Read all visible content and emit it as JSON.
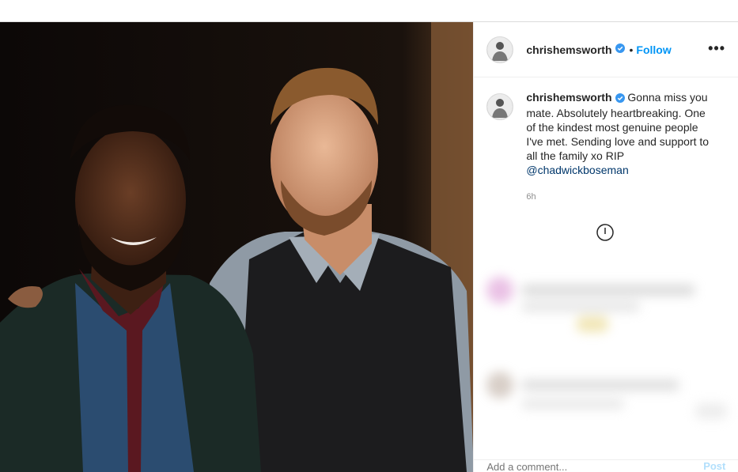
{
  "post": {
    "username": "chrishemsworth",
    "follow_label": "Follow",
    "separator": "•",
    "more_label": "•••",
    "caption_text": "Gonna miss you mate. Absolutely heartbreaking. One of the kindest most genuine people I've met. Sending love and support to all the family xo RIP",
    "mention": "@chadwickboseman",
    "time_ago": "6h",
    "comment_placeholder": "Add a comment...",
    "post_button": "Post"
  },
  "colors": {
    "link_blue": "#0095f6",
    "mention_blue": "#00376b",
    "verified_blue": "#3897f0",
    "muted_gray": "#8e8e8e"
  },
  "icons": {
    "verified": "verified-badge-icon",
    "loading": "loading-spinner-icon",
    "more": "more-options-icon"
  }
}
